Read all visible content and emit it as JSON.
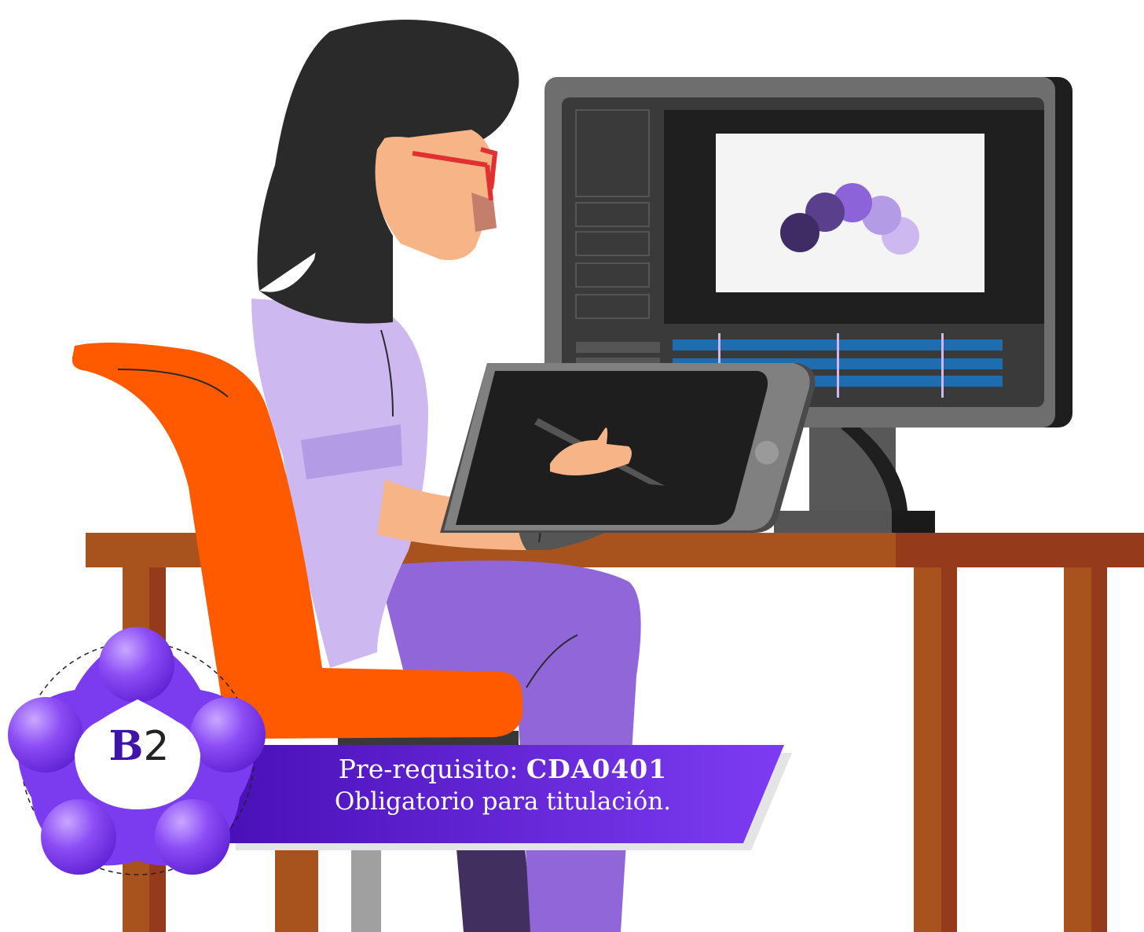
{
  "banner": {
    "prereq_label": "Pre-requisito:",
    "prereq_code": "CDA0401",
    "note": "Obligatorio para titulación."
  },
  "level": {
    "letter": "B",
    "number": "2"
  },
  "icons": [
    "level-badge-icon",
    "monitor-icon",
    "tablet-icon",
    "stylus-icon",
    "chair-icon",
    "desk-icon"
  ],
  "colors": {
    "banner_purple": "#6b2fe0",
    "badge_purple": "#7b3cf0",
    "chair_orange": "#ff5a00",
    "desk_brown": "#a8531d",
    "monitor_gray": "#4a4a4a",
    "shirt_lilac": "#cdb8f0",
    "pants_purple": "#9166d9"
  }
}
